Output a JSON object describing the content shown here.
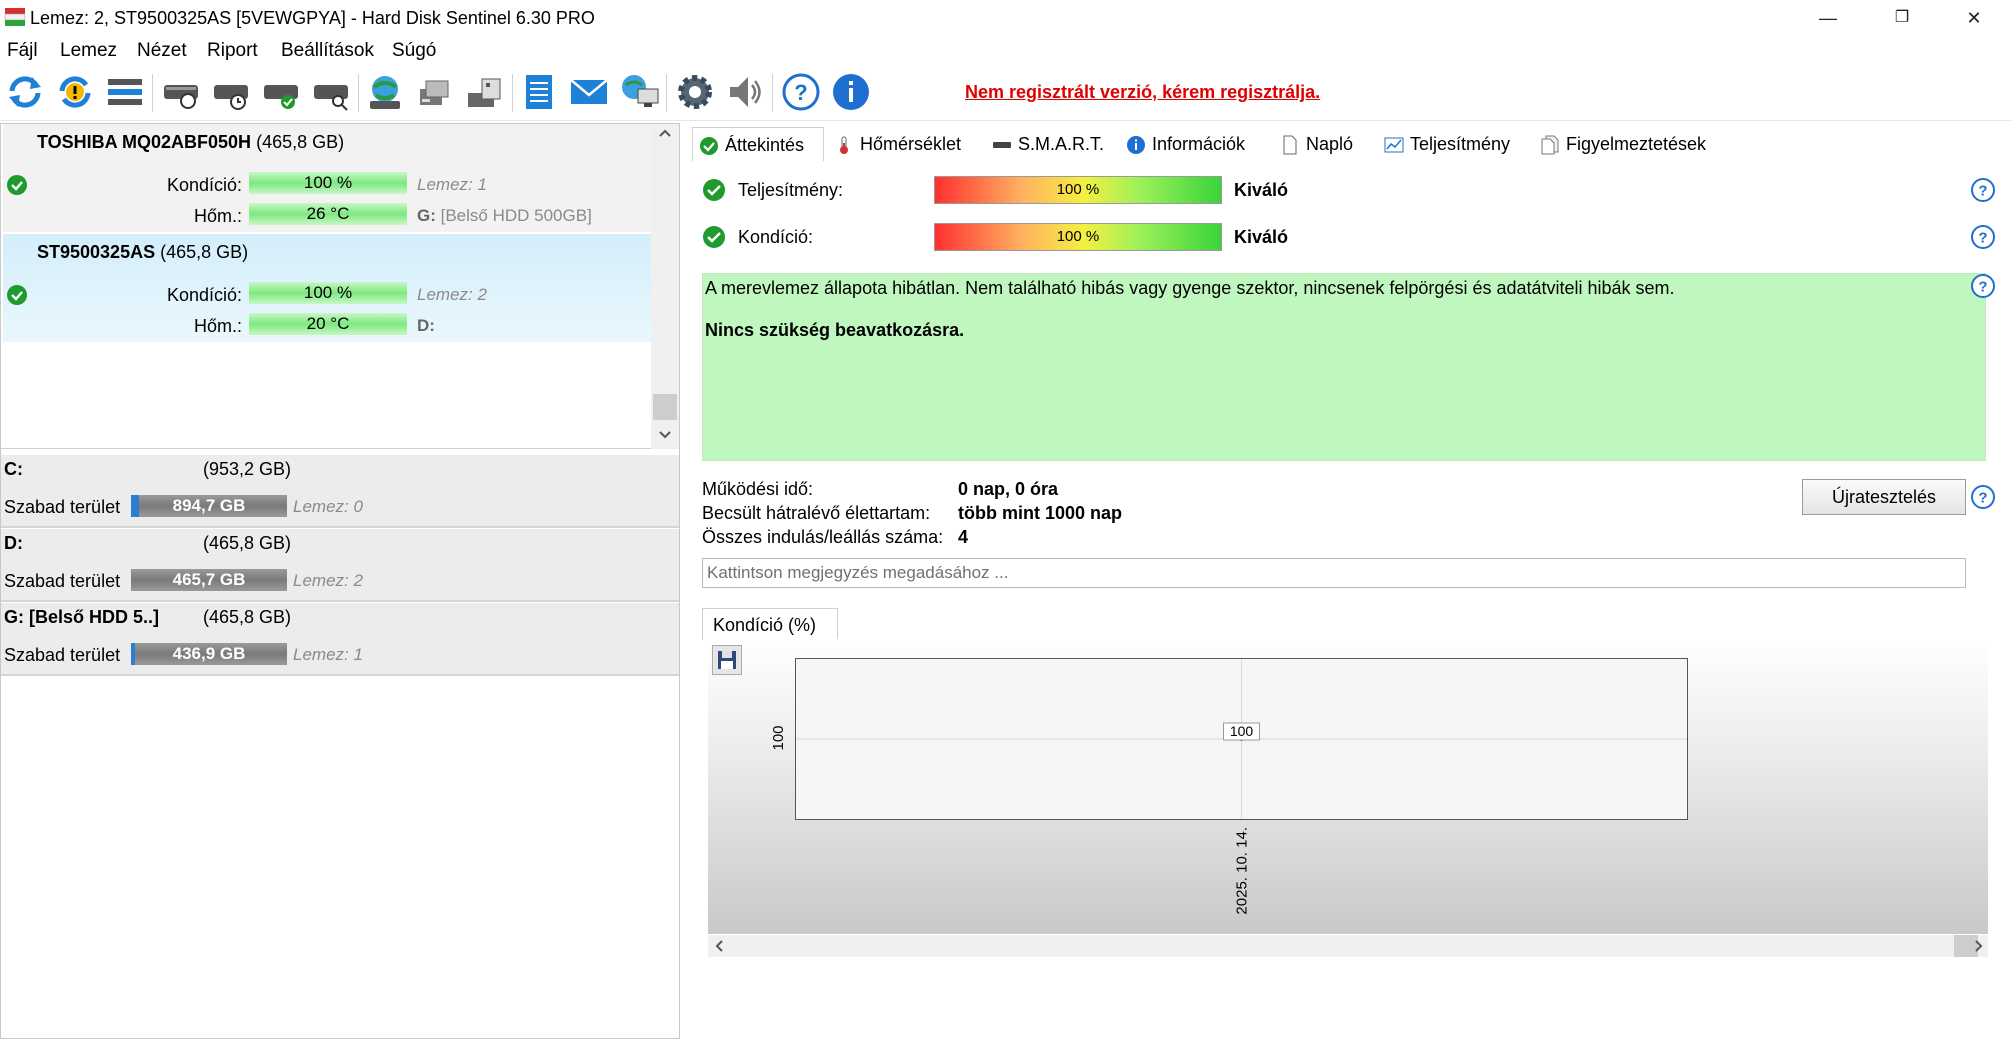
{
  "window": {
    "title": "Lemez: 2, ST9500325AS [5VEWGPYA]  -  Hard Disk Sentinel 6.30 PRO",
    "minimize": "—",
    "maximize": "❐",
    "close": "✕"
  },
  "menu": [
    "Fájl",
    "Lemez",
    "Nézet",
    "Riport",
    "Beállítások",
    "Súgó"
  ],
  "registration_warning": "Nem regisztrált verzió, kérem regisztrálja.",
  "disks": [
    {
      "model": "TOSHIBA MQ02ABF050H",
      "size": "(465,8 GB)",
      "condition_label": "Kondíció:",
      "condition": "100 %",
      "temp_label": "Hőm.:",
      "temp": "26 °C",
      "disk_ref": "Lemez: 1",
      "drive_letter": "G:",
      "drive_name": "[Belső HDD 500GB]"
    },
    {
      "model": "ST9500325AS",
      "size": "(465,8 GB)",
      "condition_label": "Kondíció:",
      "condition": "100 %",
      "temp_label": "Hőm.:",
      "temp": "20 °C",
      "disk_ref": "Lemez: 2",
      "drive_letter": "D:",
      "drive_name": ""
    }
  ],
  "volumes": [
    {
      "name": "C:",
      "size": "(953,2 GB)",
      "free_label": "Szabad terület",
      "free": "894,7 GB",
      "disk_ref": "Lemez: 0"
    },
    {
      "name": "D:",
      "size": "(465,8 GB)",
      "free_label": "Szabad terület",
      "free": "465,7 GB",
      "disk_ref": "Lemez: 2"
    },
    {
      "name": "G: [Belső HDD 5..]",
      "size": "(465,8 GB)",
      "free_label": "Szabad terület",
      "free": "436,9 GB",
      "disk_ref": "Lemez: 1"
    }
  ],
  "tabs": [
    "Áttekintés",
    "Hőmérséklet",
    "S.M.A.R.T.",
    "Információk",
    "Napló",
    "Teljesítmény",
    "Figyelmeztetések"
  ],
  "overview": {
    "performance_label": "Teljesítmény:",
    "performance_value": "100 %",
    "performance_rating": "Kiváló",
    "condition_label": "Kondíció:",
    "condition_value": "100 %",
    "condition_rating": "Kiváló",
    "message": "A merevlemez állapota hibátlan. Nem található hibás vagy gyenge szektor, nincsenek felpörgési és adatátviteli hibák sem.",
    "action": "Nincs szükség beavatkozásra.",
    "uptime_label": "Működési idő:",
    "uptime": "0 nap, 0 óra",
    "lifetime_label": "Becsült hátralévő élettartam:",
    "lifetime": "több mint 1000 nap",
    "starts_label": "Összes indulás/leállás száma:",
    "starts": "4",
    "retest_button": "Újratesztelés",
    "note_placeholder": "Kattintson megjegyzés megadásához ..."
  },
  "graph_tab": "Kondíció  (%)",
  "chart_data": {
    "type": "line",
    "title": "",
    "x": [
      "2025. 10. 14."
    ],
    "series": [
      {
        "values": [
          100
        ]
      }
    ],
    "y_tick": "100",
    "point_label": "100",
    "xlabel": "",
    "ylabel": ""
  },
  "colors": {
    "ok_green": "#1e9a2e",
    "warning_red": "#e00000",
    "selected_row": "#d8f1fb"
  }
}
